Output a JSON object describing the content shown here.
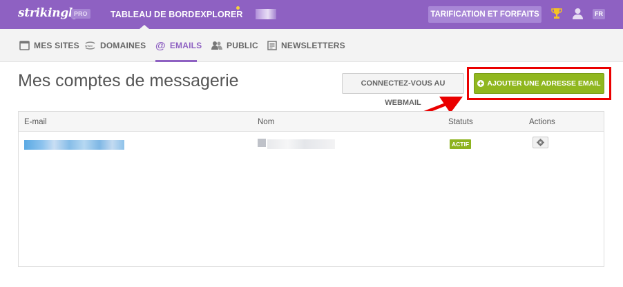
{
  "topbar": {
    "logo": "strikingly",
    "badge": "PRO",
    "nav": [
      {
        "label": "TABLEAU DE BORD"
      },
      {
        "label": "EXPLORER"
      }
    ],
    "pricing_label": "TARIFICATION ET FORFAITS",
    "language": "FR",
    "icons": [
      "trophy-icon",
      "user-icon"
    ],
    "accent_color": "#8e61c2",
    "notification_color": "#f7d33b"
  },
  "subnav": {
    "items": [
      {
        "label": "MES SITES",
        "icon": "browser-window-icon"
      },
      {
        "label": "DOMAINES",
        "icon": "domain-icon"
      },
      {
        "label": "EMAILS",
        "icon": "at-icon",
        "active": true
      },
      {
        "label": "PUBLIC",
        "icon": "users-icon"
      },
      {
        "label": "NEWSLETTERS",
        "icon": "newsletter-icon"
      }
    ]
  },
  "main": {
    "title": "Mes comptes de messagerie",
    "webmail_button": "CONNECTEZ-VOUS AU WEBMAIL",
    "add_button": "AJOUTER UNE ADRESSE EMAIL",
    "add_button_color": "#90b71f",
    "highlight_color": "#ea0000"
  },
  "table": {
    "columns": [
      "E-mail",
      "Nom",
      "Statuts",
      "Actions"
    ],
    "rows": [
      {
        "status": "ACTIF",
        "status_color": "#8db31f"
      }
    ]
  }
}
